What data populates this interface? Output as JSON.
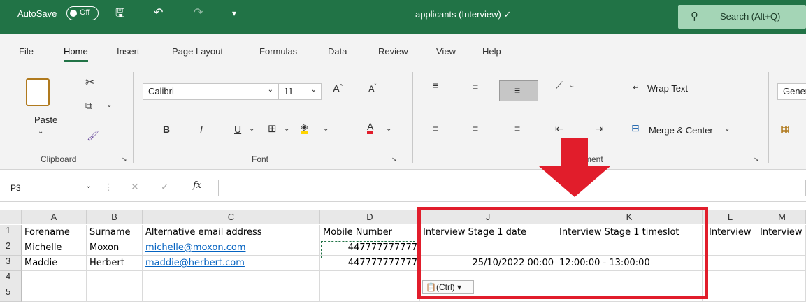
{
  "titlebar": {
    "autosave_label": "AutoSave",
    "toggle_state": "Off",
    "doc_title": "applicants (Interview) ✓",
    "search_placeholder": "Search (Alt+Q)"
  },
  "menu": [
    "File",
    "Home",
    "Insert",
    "Page Layout",
    "Formulas",
    "Data",
    "Review",
    "View",
    "Help"
  ],
  "ribbon": {
    "paste_label": "Paste",
    "font_name": "Calibri",
    "font_size": "11",
    "wrap_text": "Wrap Text",
    "merge_center": "Merge & Center",
    "number_format": "Gener",
    "groups": {
      "clipboard": "Clipboard",
      "font": "Font",
      "alignment": "ment"
    }
  },
  "formula_bar": {
    "name_box": "P3",
    "fx": "fx",
    "value": ""
  },
  "grid": {
    "columns": [
      "A",
      "B",
      "C",
      "D",
      "J",
      "K",
      "L",
      "M"
    ],
    "rows": [
      "1",
      "2",
      "3",
      "4",
      "5"
    ],
    "cells": [
      [
        "Forename",
        "Surname",
        "Alternative email address",
        "Mobile Number",
        "Interview Stage 1 date",
        "Interview Stage 1 timeslot",
        "Interview",
        "Interview"
      ],
      [
        "Michelle",
        "Moxon",
        "michelle@moxon.com",
        "447777777777",
        "",
        "",
        "",
        ""
      ],
      [
        "Maddie",
        "Herbert",
        "maddie@herbert.com",
        "447777777777",
        "25/10/2022 00:00",
        "12:00:00 - 13:00:00",
        "",
        ""
      ],
      [
        "",
        "",
        "",
        "",
        "",
        "",
        "",
        ""
      ],
      [
        "",
        "",
        "",
        "",
        "",
        "",
        "",
        ""
      ]
    ],
    "paste_options": "(Ctrl) ▾"
  },
  "colors": {
    "excel_green": "#217346",
    "highlight_red": "#e11d2b",
    "link_blue": "#0563c1"
  }
}
